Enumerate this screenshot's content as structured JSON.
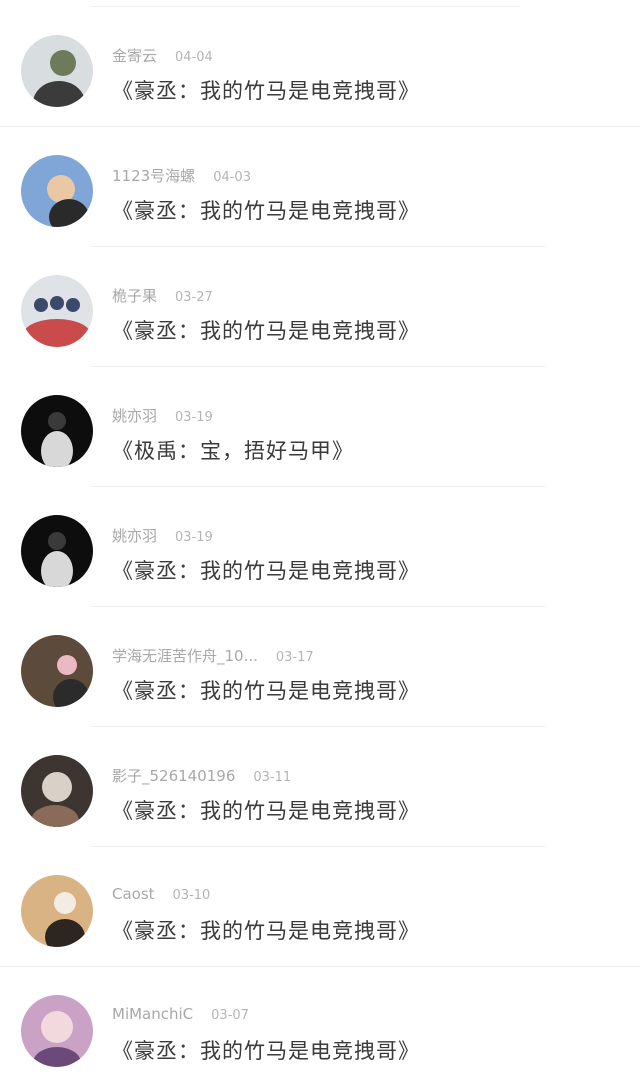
{
  "items": [
    {
      "name": "金寄云",
      "date": "04-04",
      "title": "《豪丞：我的竹马是电竞拽哥》",
      "avatar_colors": [
        "#d8dde0",
        "#6e7b5a",
        "#3b3b3b"
      ]
    },
    {
      "name": "1123号海螺",
      "date": "04-03",
      "title": "《豪丞：我的竹马是电竞拽哥》",
      "avatar_colors": [
        "#7fa6d6",
        "#e9c8a6",
        "#2a2a2a"
      ]
    },
    {
      "name": "桅子果",
      "date": "03-27",
      "title": "《豪丞：我的竹马是电竞拽哥》",
      "avatar_colors": [
        "#dfe3e8",
        "#3b4a6b",
        "#c94b4b"
      ]
    },
    {
      "name": "姚亦羽",
      "date": "03-19",
      "title": "《极禹：宝，捂好马甲》",
      "avatar_colors": [
        "#0d0d0d",
        "#3a3a3a",
        "#d8d8d8"
      ]
    },
    {
      "name": "姚亦羽",
      "date": "03-19",
      "title": "《豪丞：我的竹马是电竞拽哥》",
      "avatar_colors": [
        "#0d0d0d",
        "#3a3a3a",
        "#d8d8d8"
      ]
    },
    {
      "name": "学海无涯苦作舟_10...",
      "date": "03-17",
      "title": "《豪丞：我的竹马是电竞拽哥》",
      "avatar_colors": [
        "#5c4a3a",
        "#e9b9c4",
        "#2b2b2b"
      ]
    },
    {
      "name": "影子_526140196",
      "date": "03-11",
      "title": "《豪丞：我的竹马是电竞拽哥》",
      "avatar_colors": [
        "#3d3530",
        "#d9d0c8",
        "#8a6a58"
      ]
    },
    {
      "name": "Caost",
      "date": "03-10",
      "title": "《豪丞：我的竹马是电竞拽哥》",
      "avatar_colors": [
        "#d9b383",
        "#f2ece3",
        "#2d2520"
      ]
    },
    {
      "name": "MiManchiC",
      "date": "03-07",
      "title": "《豪丞：我的竹马是电竞拽哥》",
      "avatar_colors": [
        "#c9a2c6",
        "#f1d9dd",
        "#6b4a7a"
      ]
    }
  ]
}
